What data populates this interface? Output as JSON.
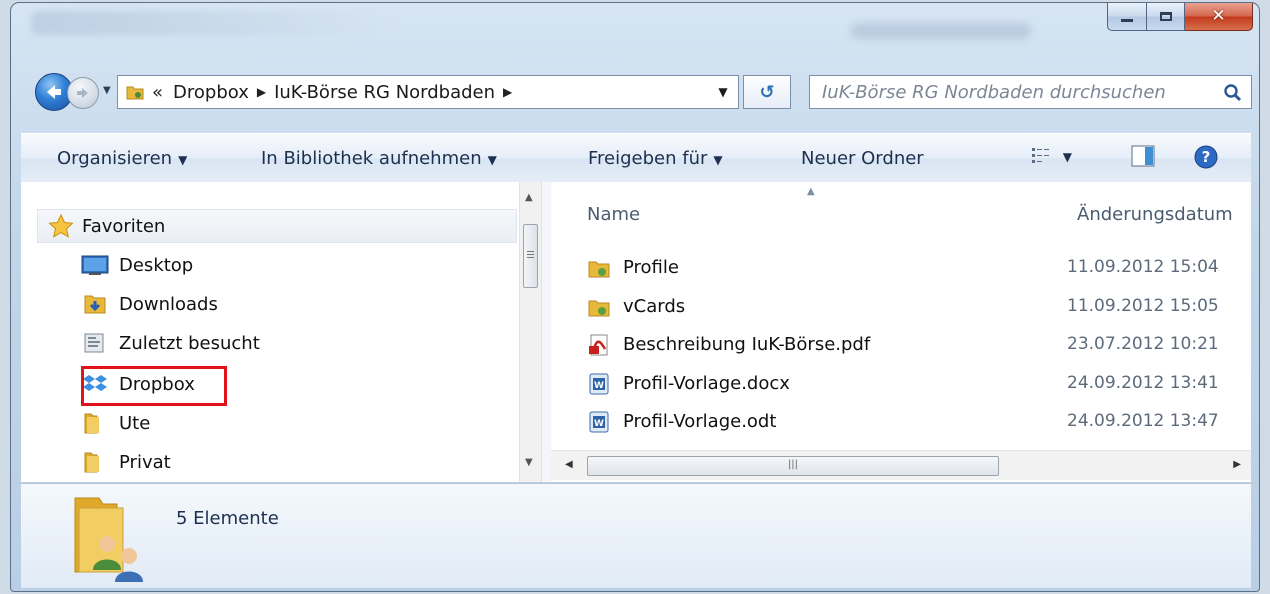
{
  "address": {
    "overflow": "«",
    "crumbs": [
      "Dropbox",
      "IuK-Börse RG Nordbaden"
    ]
  },
  "search": {
    "placeholder": "IuK-Börse RG Nordbaden durchsuchen"
  },
  "toolbar": {
    "organize": "Organisieren",
    "library": "In Bibliothek aufnehmen",
    "share": "Freigeben für",
    "new_folder": "Neuer Ordner"
  },
  "nav": {
    "favorites": "Favoriten",
    "items": [
      {
        "label": "Desktop",
        "icon": "desktop-icon"
      },
      {
        "label": "Downloads",
        "icon": "downloads-folder-icon"
      },
      {
        "label": "Zuletzt besucht",
        "icon": "recent-places-icon"
      },
      {
        "label": "Dropbox",
        "icon": "dropbox-icon",
        "highlighted": true
      },
      {
        "label": "Ute",
        "icon": "folder-icon"
      },
      {
        "label": "Privat",
        "icon": "folder-icon"
      }
    ]
  },
  "columns": {
    "name": "Name",
    "date": "Änderungsdatum"
  },
  "files": [
    {
      "name": "Profile",
      "date": "11.09.2012 15:04",
      "type": "folder"
    },
    {
      "name": "vCards",
      "date": "11.09.2012 15:05",
      "type": "folder"
    },
    {
      "name": "Beschreibung IuK-Börse.pdf",
      "date": "23.07.2012 10:21",
      "type": "pdf"
    },
    {
      "name": "Profil-Vorlage.docx",
      "date": "24.09.2012 13:41",
      "type": "word"
    },
    {
      "name": "Profil-Vorlage.odt",
      "date": "24.09.2012 13:47",
      "type": "word"
    }
  ],
  "status": {
    "count": "5 Elemente"
  },
  "colors": {
    "highlight": "#e0131b",
    "folder": "#e8b83a"
  }
}
